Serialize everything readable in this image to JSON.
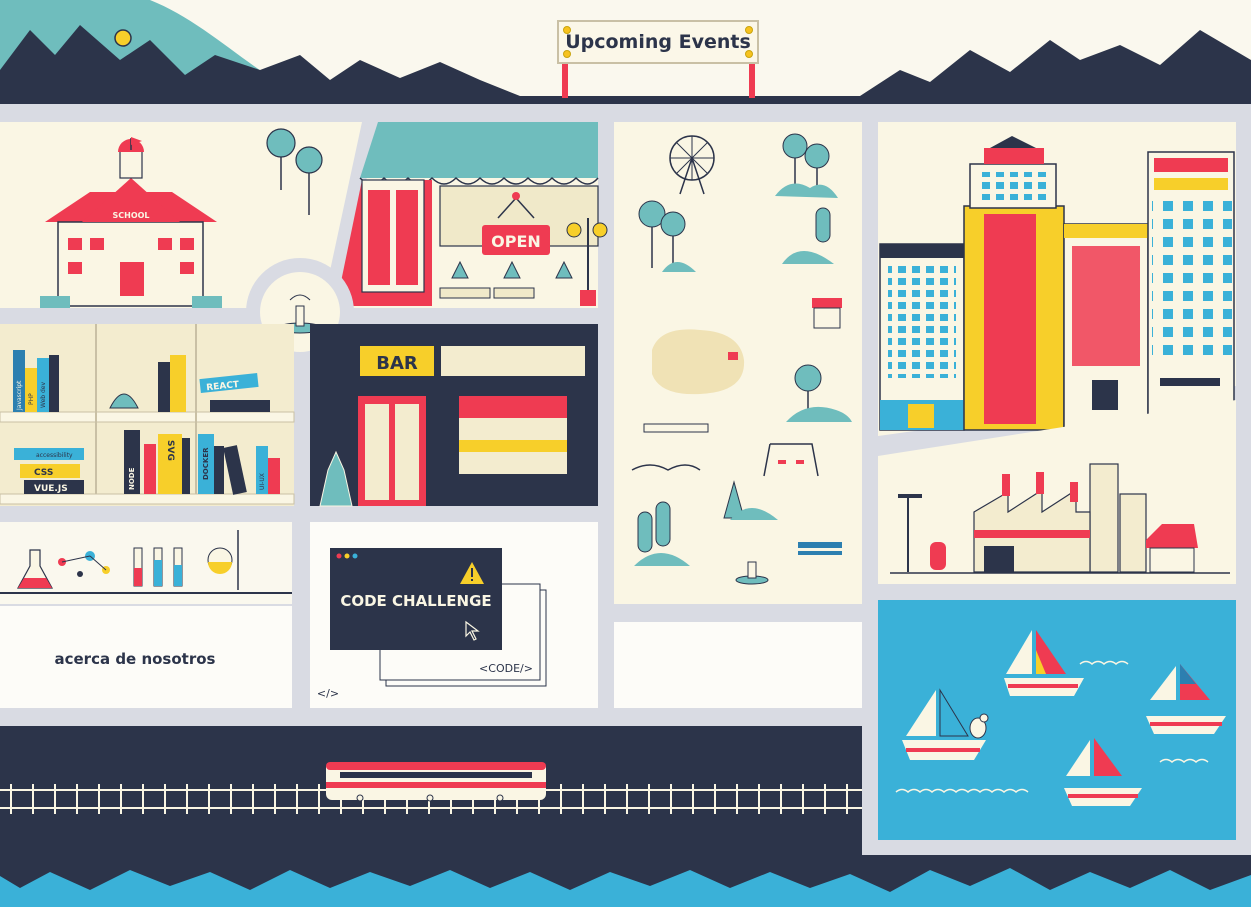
{
  "header": {
    "events_sign": "Upcoming Events"
  },
  "school": {
    "sign": "SCHOOL"
  },
  "shop": {
    "open_sign": "OPEN"
  },
  "bar": {
    "sign": "BAR"
  },
  "library": {
    "books": [
      "Javascript",
      "PHP",
      "Web dev",
      "NODE",
      "SVG",
      "DOCKER",
      "UI-UX"
    ],
    "stacks": [
      "REACT",
      "accessibility",
      "CSS",
      "VUE.JS"
    ]
  },
  "about": {
    "label": "acerca de nosotros"
  },
  "code": {
    "title": "CODE CHALLENGE",
    "tag": "<CODE/>",
    "tag_small": "</>"
  },
  "colors": {
    "navy": "#2c344a",
    "teal": "#6fbdbd",
    "red": "#ef3b52",
    "yellow": "#f7cf2a",
    "cream": "#faf6e4",
    "sea": "#3ab1d8",
    "road": "#d9dbe3"
  },
  "icons": [
    "sun-icon",
    "fountain-icon",
    "ferris-wheel-icon",
    "warning-icon",
    "cursor-icon",
    "train-icon",
    "sailboat-icon",
    "seagull-icon",
    "tree-icon",
    "flask-icon"
  ]
}
